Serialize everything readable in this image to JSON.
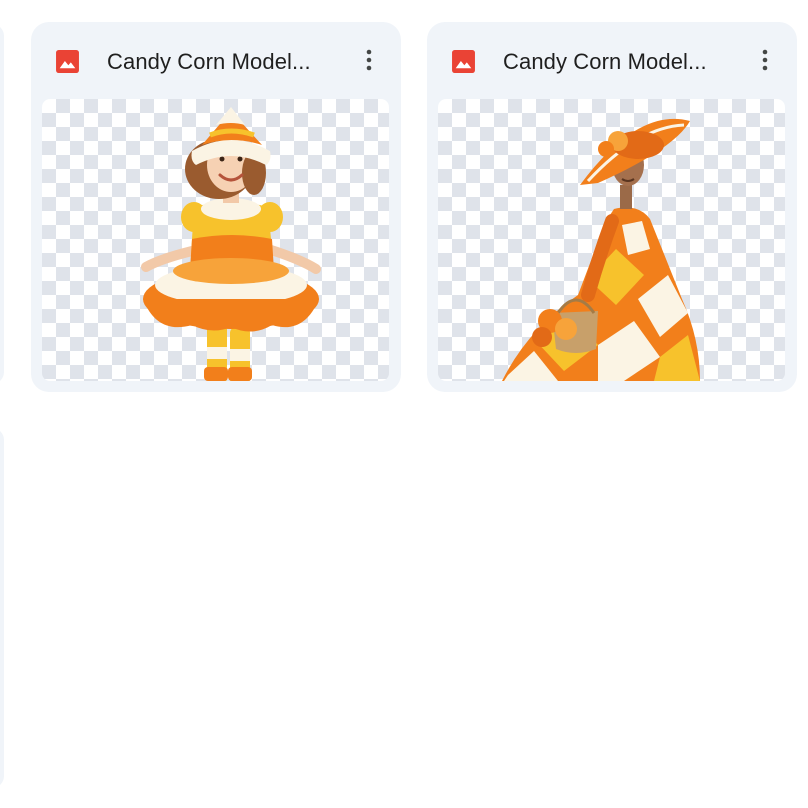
{
  "files": [
    {
      "name": "Candy Corn Model...",
      "type_icon": "image-file-icon",
      "menu_icon": "more-vert-icon",
      "preview": "girl-in-candy-corn-tutu-dress"
    },
    {
      "name": "Candy Corn Model...",
      "type_icon": "image-file-icon",
      "menu_icon": "more-vert-icon",
      "preview": "woman-in-candy-corn-gown-with-sunhat"
    }
  ],
  "colors": {
    "card_background": "#f0f4f9",
    "image_icon": "#ea4335",
    "title_text": "#1f1f1f",
    "candy_orange": "#f27f1b",
    "candy_yellow": "#f7c22c",
    "candy_white": "#fbf4e4"
  }
}
